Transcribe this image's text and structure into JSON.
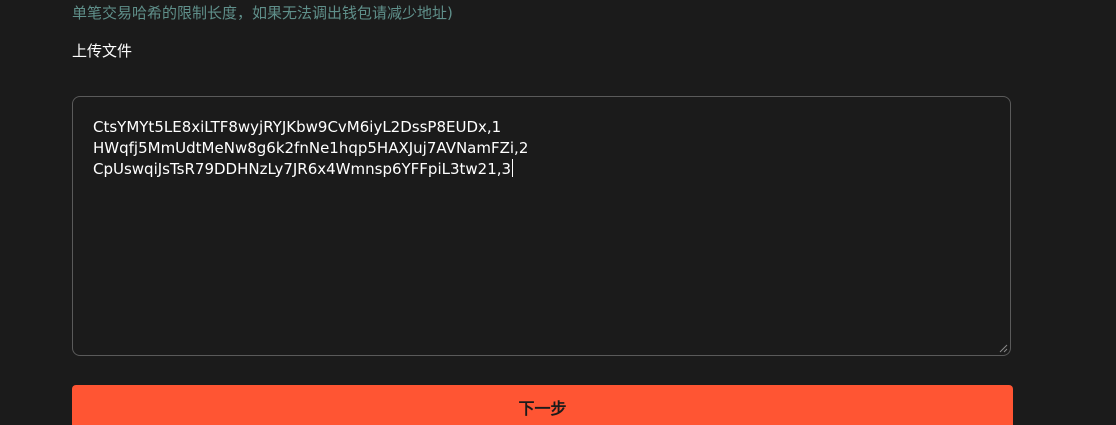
{
  "hint": {
    "text": "单笔交易哈希的限制长度，如果无法调出钱包请减少地址)"
  },
  "upload": {
    "label": "上传文件"
  },
  "textarea": {
    "lines": [
      "CtsYMYt5LE8xiLTF8wyjRYJKbw9CvM6iyL2DssP8EUDx,1",
      "HWqfj5MmUdtMeNw8g6k2fnNe1hqp5HAXJuj7AVNamFZi,2",
      "CpUswqiJsTsR79DDHNzLy7JR6x4Wmnsp6YFFpiL3tw21,3"
    ]
  },
  "button": {
    "next_label": "下一步"
  },
  "colors": {
    "background": "#1b1b1b",
    "accent": "#ff5533",
    "hint": "#5f8f8a",
    "border": "#5a5a5a"
  }
}
